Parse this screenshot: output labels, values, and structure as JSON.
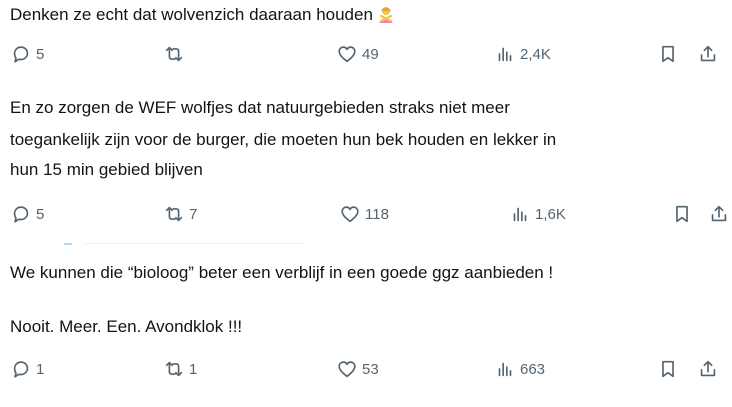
{
  "colors": {
    "text": "#0f1419",
    "muted": "#536471",
    "accent": "#1d9bf0"
  },
  "posts": [
    {
      "text_lines": [
        "Denken ze echt dat wolvenzich daaraan houden"
      ],
      "emoji": "person-gesturing-no-emoji",
      "actions": {
        "replies": "5",
        "reposts": "",
        "likes": "49",
        "views": "2,4K"
      }
    },
    {
      "text_lines": [
        "En zo zorgen de WEF wolfjes dat natuurgebieden straks niet meer",
        "toegankelijk zijn voor de burger, die moeten hun bek houden en lekker in",
        "hun 15 min gebied blijven"
      ],
      "actions": {
        "replies": "5",
        "reposts": "7",
        "likes": "118",
        "views": "1,6K"
      }
    },
    {
      "text_lines": [
        "We kunnen die “bioloog” beter een verblijf in een goede ggz aanbieden !",
        "Nooit. Meer. Een. Avondklok !!!"
      ],
      "actions": {
        "replies": "1",
        "reposts": "1",
        "likes": "53",
        "views": "663"
      }
    }
  ]
}
